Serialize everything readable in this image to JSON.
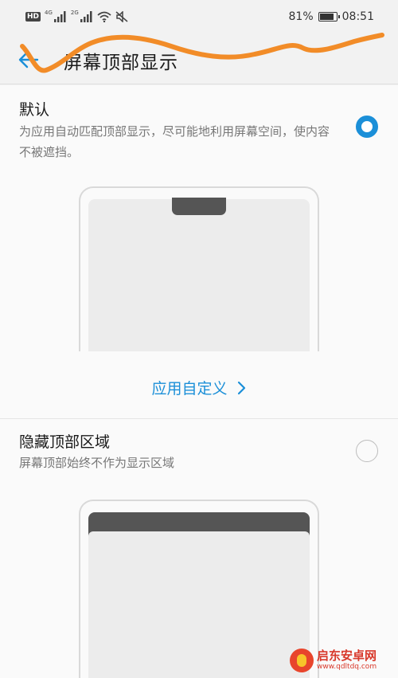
{
  "status_bar": {
    "hd": "HD",
    "net1": "4G",
    "net2": "2G",
    "battery_text": "81%",
    "battery_level": 0.81,
    "time": "08:51",
    "icons": [
      "signal-icon",
      "signal-icon",
      "wifi-icon",
      "mute-icon",
      "battery-icon"
    ]
  },
  "header": {
    "title": "屏幕顶部显示",
    "back_icon": "back-arrow-icon"
  },
  "options": [
    {
      "title": "默认",
      "description": "为应用自动匹配顶部显示，尽可能地利用屏幕空间，使内容不被遮挡。",
      "selected": true
    },
    {
      "title": "隐藏顶部区域",
      "description": "屏幕顶部始终不作为显示区域",
      "selected": false
    }
  ],
  "custom_link": {
    "label": "应用自定义",
    "icon": "chevron-right-icon"
  },
  "colors": {
    "accent": "#1b8fd8",
    "scribble": "#f28c28",
    "notch": "#555555"
  },
  "watermark": {
    "name": "启东安卓网",
    "url": "www.qdltdq.com"
  }
}
